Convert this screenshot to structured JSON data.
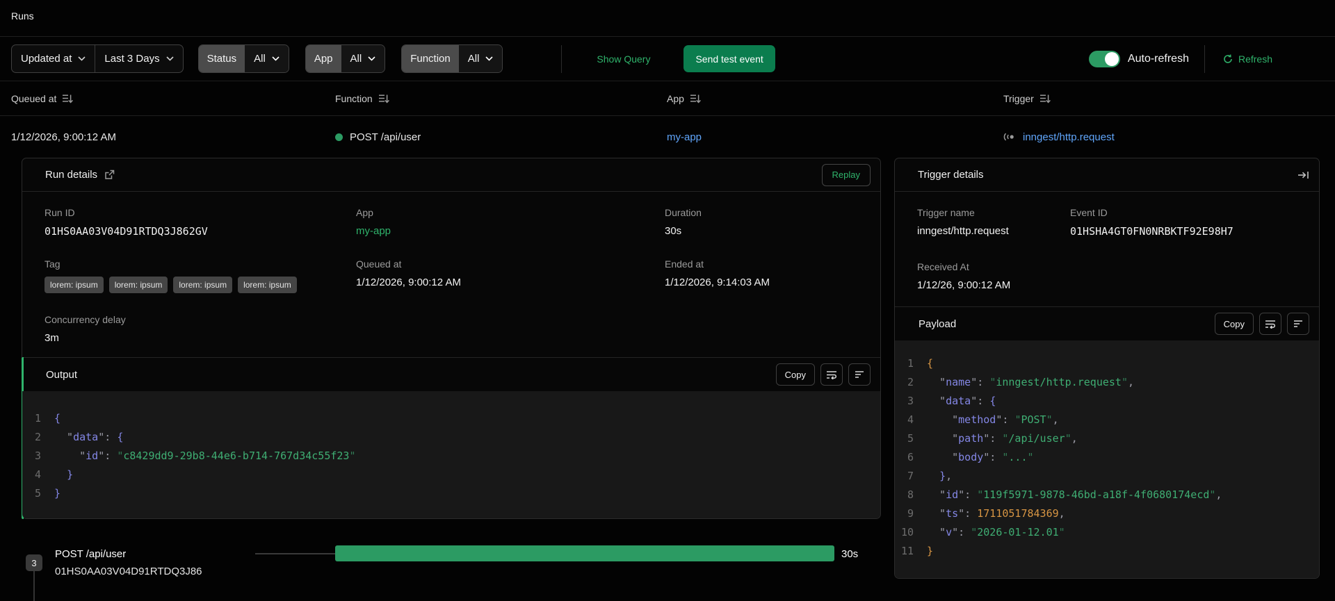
{
  "page": {
    "title": "Runs"
  },
  "colors": {
    "accent_green": "#2fb36b",
    "button_green": "#0b7d4e",
    "bar_green": "#2c9b63",
    "status_dot_green": "#2c9b63",
    "link_blue": "#60a5fa"
  },
  "filters": {
    "time_field": {
      "value": "Updated at"
    },
    "time_range": {
      "value": "Last 3 Days"
    },
    "status": {
      "label": "Status",
      "value": "All"
    },
    "app": {
      "label": "App",
      "value": "All"
    },
    "function": {
      "label": "Function",
      "value": "All"
    },
    "show_query": "Show Query",
    "send_test_event": "Send test event",
    "auto_refresh": {
      "label": "Auto-refresh",
      "enabled": true
    },
    "refresh": "Refresh"
  },
  "table": {
    "columns": [
      "Queued at",
      "Function",
      "App",
      "Trigger"
    ],
    "row": {
      "queued_at": "1/12/2026, 9:00:12 AM",
      "function": "POST /api/user",
      "app": "my-app",
      "trigger": "inngest/http.request"
    }
  },
  "run_details": {
    "title": "Run details",
    "replay_label": "Replay",
    "run_id": {
      "label": "Run ID",
      "value": "01HS0AA03V04D91RTDQ3J862GV"
    },
    "app": {
      "label": "App",
      "value": "my-app"
    },
    "duration": {
      "label": "Duration",
      "value": "30s"
    },
    "tag": {
      "label": "Tag",
      "values": [
        "lorem: ipsum",
        "lorem: ipsum",
        "lorem: ipsum",
        "lorem: ipsum"
      ]
    },
    "queued_at": {
      "label": "Queued at",
      "value": "1/12/2026, 9:00:12 AM"
    },
    "ended_at": {
      "label": "Ended at",
      "value": "1/12/2026, 9:14:03 AM"
    },
    "concurrency_delay": {
      "label": "Concurrency delay",
      "value": "3m"
    },
    "output": {
      "title": "Output",
      "copy_label": "Copy",
      "lines": [
        [
          [
            "b2",
            "{"
          ]
        ],
        [
          [
            "pu",
            "  \""
          ],
          [
            "key",
            "data"
          ],
          [
            "pu",
            "\": "
          ],
          [
            "b2",
            "{"
          ]
        ],
        [
          [
            "pu",
            "    \""
          ],
          [
            "key",
            "id"
          ],
          [
            "pu",
            "\": "
          ],
          [
            "sq",
            "\""
          ],
          [
            "str",
            "c8429dd9-29b8-44e6-b714-767d34c55f23"
          ],
          [
            "sq",
            "\""
          ]
        ],
        [
          [
            "pu",
            "  "
          ],
          [
            "b2",
            "}"
          ]
        ],
        [
          [
            "b2",
            "}"
          ]
        ]
      ]
    }
  },
  "trigger_details": {
    "title": "Trigger details",
    "trigger_name": {
      "label": "Trigger name",
      "value": "inngest/http.request"
    },
    "event_id": {
      "label": "Event ID",
      "value": "01HSHA4GT0FN0NRBKTF92E98H7"
    },
    "received_at": {
      "label": "Received At",
      "value": "1/12/26, 9:00:12 AM"
    },
    "payload": {
      "title": "Payload",
      "copy_label": "Copy",
      "lines": [
        [
          [
            "b1",
            "{"
          ]
        ],
        [
          [
            "pu",
            "  \""
          ],
          [
            "key",
            "name"
          ],
          [
            "pu",
            "\": "
          ],
          [
            "sq",
            "\""
          ],
          [
            "str",
            "inngest/http.request"
          ],
          [
            "sq",
            "\""
          ],
          [
            "pu",
            ","
          ]
        ],
        [
          [
            "pu",
            "  \""
          ],
          [
            "key",
            "data"
          ],
          [
            "pu",
            "\": "
          ],
          [
            "b2",
            "{"
          ]
        ],
        [
          [
            "pu",
            "    \""
          ],
          [
            "key",
            "method"
          ],
          [
            "pu",
            "\": "
          ],
          [
            "sq",
            "\""
          ],
          [
            "str",
            "POST"
          ],
          [
            "sq",
            "\""
          ],
          [
            "pu",
            ","
          ]
        ],
        [
          [
            "pu",
            "    \""
          ],
          [
            "key",
            "path"
          ],
          [
            "pu",
            "\": "
          ],
          [
            "sq",
            "\""
          ],
          [
            "str",
            "/api/user"
          ],
          [
            "sq",
            "\""
          ],
          [
            "pu",
            ","
          ]
        ],
        [
          [
            "pu",
            "    \""
          ],
          [
            "key",
            "body"
          ],
          [
            "pu",
            "\": "
          ],
          [
            "sq",
            "\""
          ],
          [
            "str",
            "..."
          ],
          [
            "sq",
            "\""
          ]
        ],
        [
          [
            "pu",
            "  "
          ],
          [
            "b2",
            "}"
          ],
          [
            "pu",
            ","
          ]
        ],
        [
          [
            "pu",
            "  \""
          ],
          [
            "key",
            "id"
          ],
          [
            "pu",
            "\": "
          ],
          [
            "sq",
            "\""
          ],
          [
            "str",
            "119f5971-9878-46bd-a18f-4f0680174ecd"
          ],
          [
            "sq",
            "\""
          ],
          [
            "pu",
            ","
          ]
        ],
        [
          [
            "pu",
            "  \""
          ],
          [
            "key",
            "ts"
          ],
          [
            "pu",
            "\": "
          ],
          [
            "num",
            "1711051784369"
          ],
          [
            "pu",
            ","
          ]
        ],
        [
          [
            "pu",
            "  \""
          ],
          [
            "key",
            "v"
          ],
          [
            "pu",
            "\": "
          ],
          [
            "sq",
            "\""
          ],
          [
            "str",
            "2026-01-12.01"
          ],
          [
            "sq",
            "\""
          ]
        ],
        [
          [
            "b1",
            "}"
          ]
        ]
      ]
    }
  },
  "timeline": {
    "step_count": "3",
    "name": "POST /api/user",
    "run_id": "01HS0AA03V04D91RTDQ3J86",
    "duration": "30s"
  }
}
